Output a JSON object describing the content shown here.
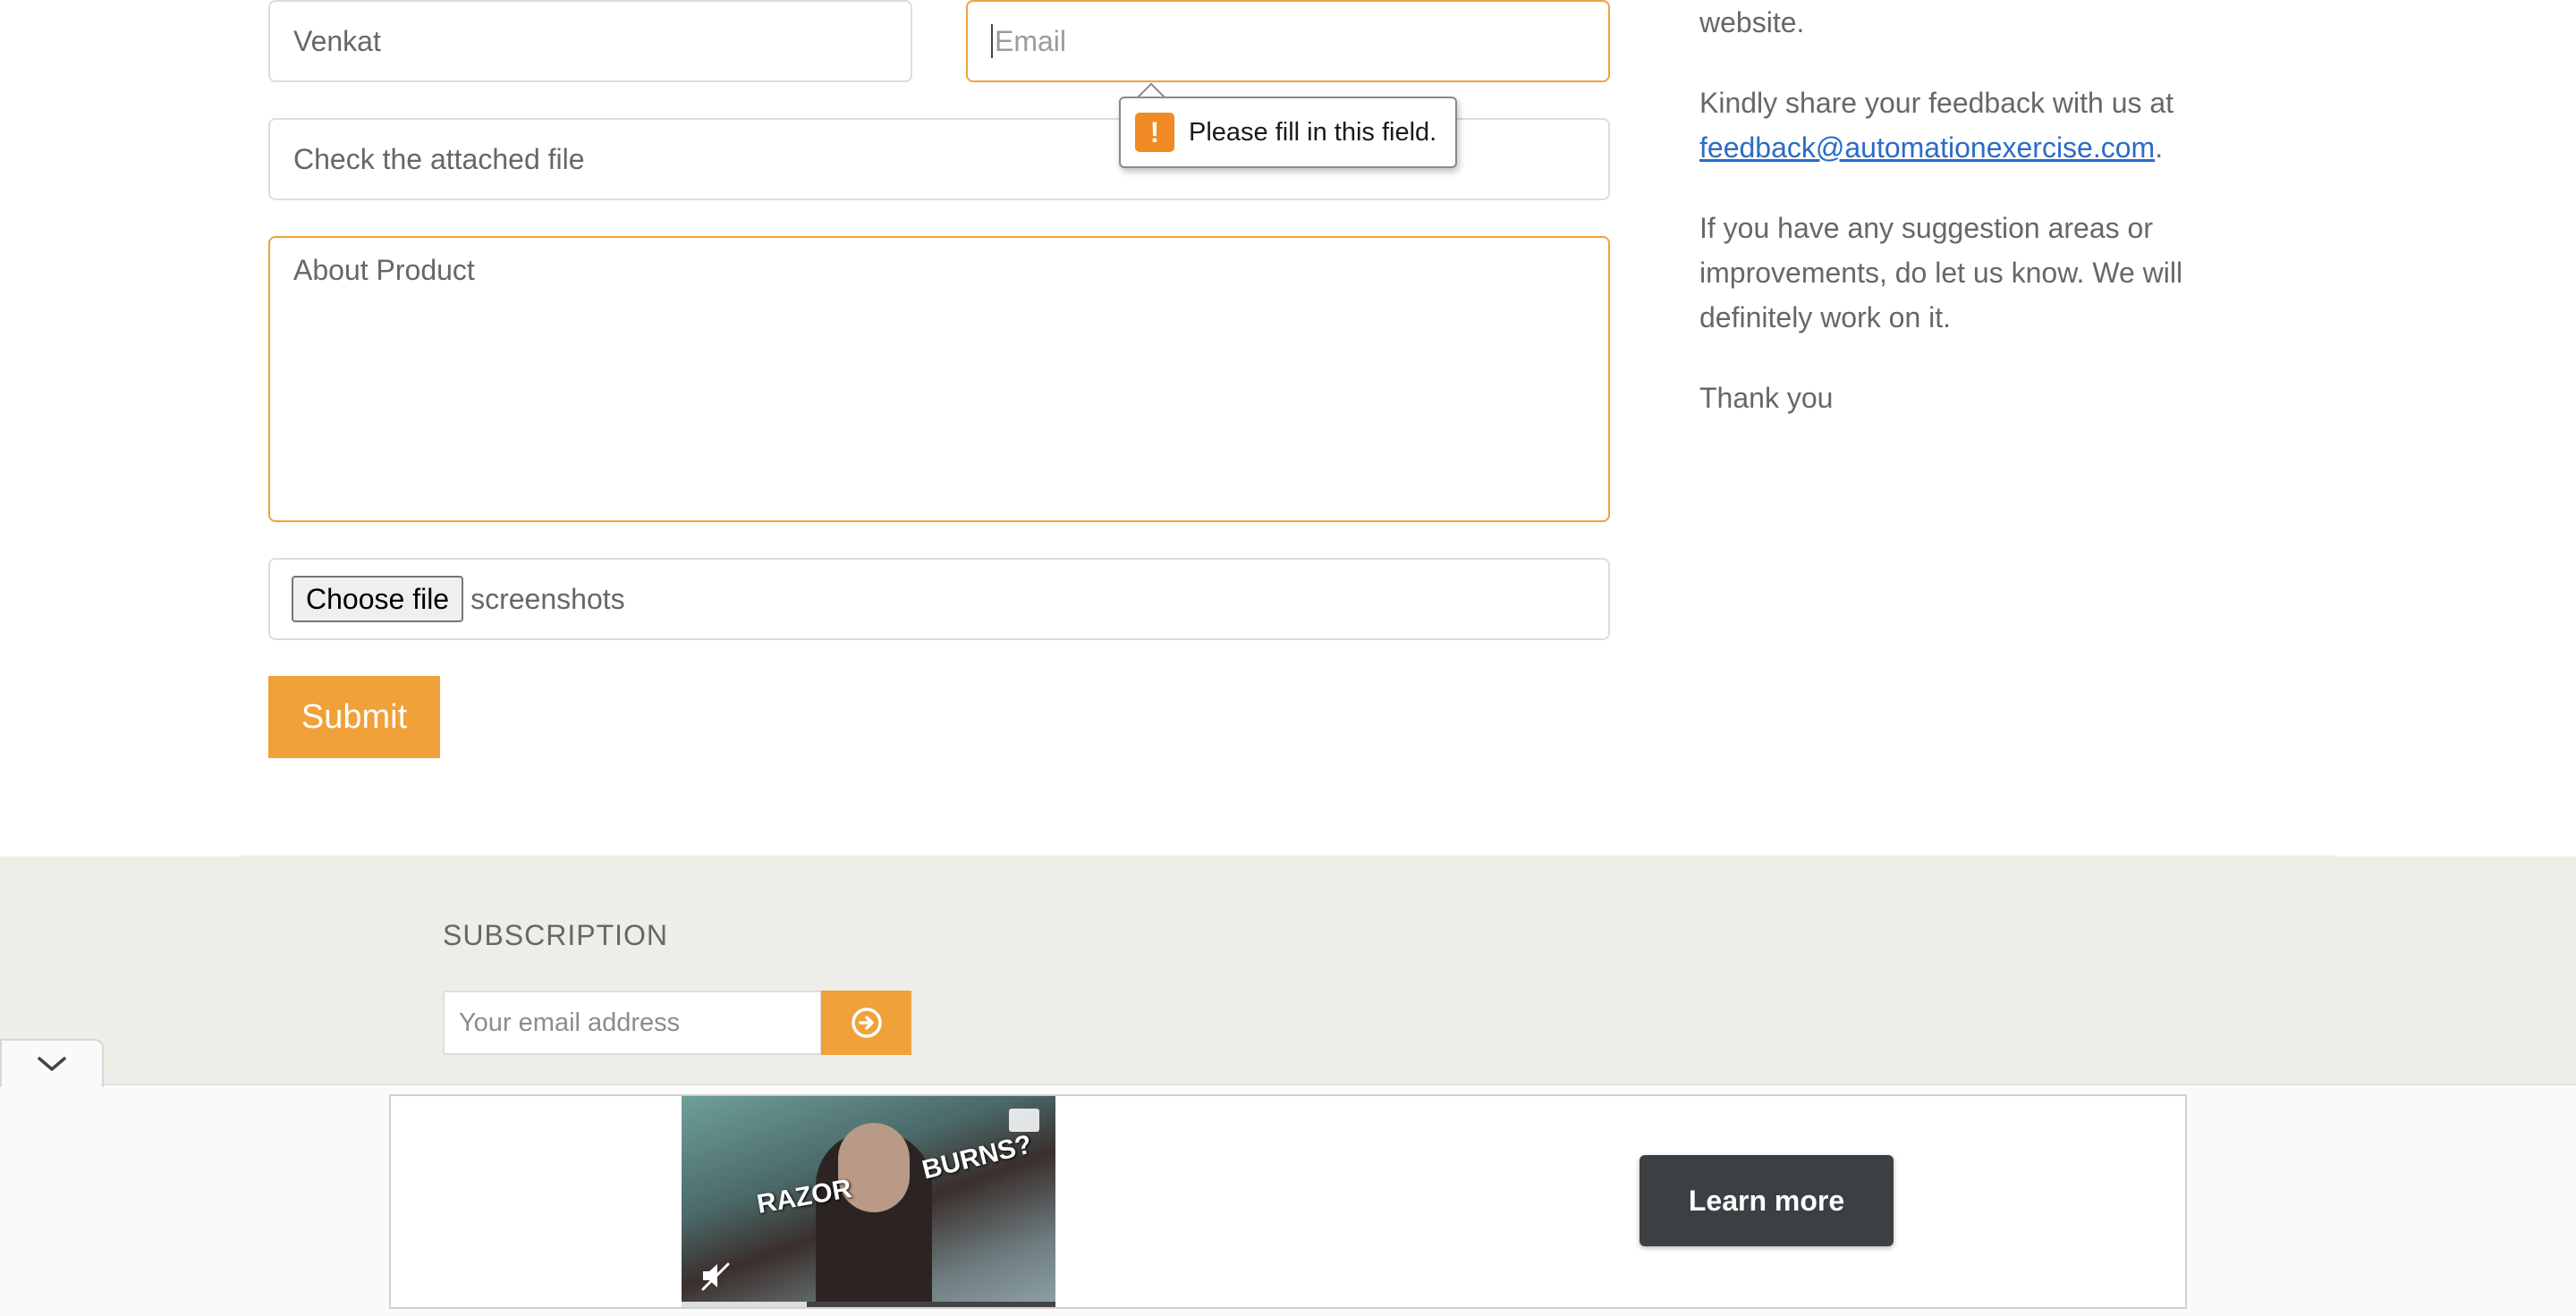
{
  "form": {
    "name_value": "Venkat",
    "email_placeholder": "Email",
    "subject_value": "Check the attached file",
    "message_value": "About Product",
    "file_button": "Choose file",
    "file_name": "screenshots",
    "submit_label": "Submit",
    "validation_message": "Please fill in this field."
  },
  "side": {
    "line1": "website.",
    "feedback_text": "Kindly share your feedback with us at",
    "feedback_email": "feedback@automationexercise.com",
    "feedback_period": ".",
    "suggest_1": "If you have any suggestion areas or",
    "suggest_2": "improvements, do let us know. We will",
    "suggest_3": "definitely work on it.",
    "thanks": "Thank you"
  },
  "footer": {
    "subscription_title": "SUBSCRIPTION",
    "email_placeholder": "Your email address"
  },
  "ad": {
    "caption_left": "RAZOR",
    "caption_right": "BURNS?",
    "cta_label": "Learn more"
  },
  "colors": {
    "accent": "#f0a13a",
    "footer_bg": "#eeeee8",
    "link": "#2b6cc4",
    "warning": "#f08a24",
    "cta_bg": "#3c4043"
  },
  "icons": {
    "warning": "exclamation-icon",
    "subscribe": "arrow-circle-right-icon",
    "collapse": "chevron-down-icon",
    "mute": "mute-icon"
  }
}
